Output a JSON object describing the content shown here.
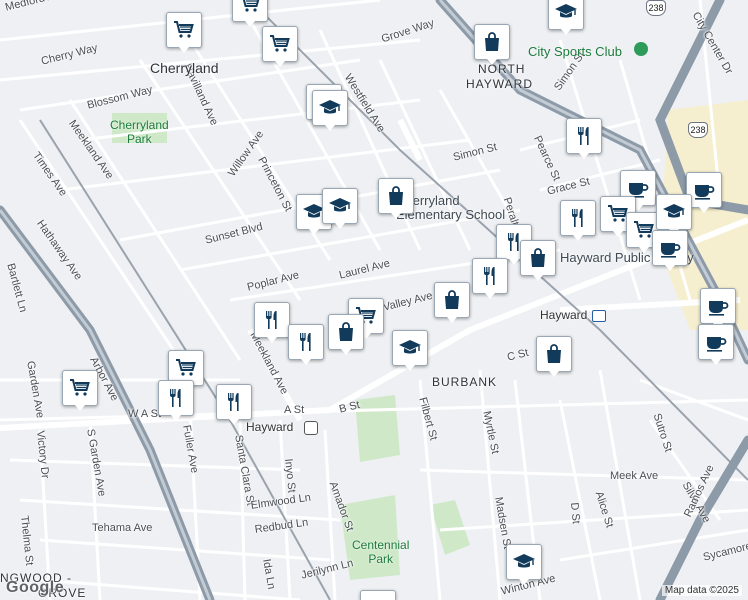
{
  "map": {
    "places": [
      {
        "text": "Cherryland",
        "cls": "place"
      },
      {
        "text": "NORTH",
        "cls": "place hood"
      },
      {
        "text": "HAYWARD",
        "cls": "place hood"
      },
      {
        "text": "BURBANK",
        "cls": "place hood"
      },
      {
        "text": "NGWOOD -",
        "cls": "place hood"
      },
      {
        "text": "GROVE",
        "cls": "place hood"
      }
    ],
    "parks": [
      {
        "text": "Cherryland\nPark"
      },
      {
        "text": "Centennial\nPark"
      }
    ],
    "pois": [
      {
        "text": "City Sports Club"
      }
    ],
    "school_label": "Cherryland Elementary School",
    "library_label": "Hayward Public Library",
    "stations": [
      {
        "text": "Hayward"
      },
      {
        "text": "Hayward"
      }
    ],
    "streets": [
      "Medford Ave",
      "Cherry Way",
      "Blossom Way",
      "Grove Way",
      "Westfield Ave",
      "Havilland Ave",
      "Meekland Ave",
      "Times Ave",
      "Willow Ave",
      "Princeton St",
      "Sunset Blvd",
      "Poplar Ave",
      "Laurel Ave",
      "Valley Ave",
      "Hathaway Ave",
      "Bartlett Ln",
      "Arbor Ave",
      "Garden Ave",
      "S Garden Ave",
      "Victory Dr",
      "Thelma St",
      "W A St",
      "Fuller Ave",
      "Santa Clara St",
      "Inyo St",
      "Amador St",
      "A St",
      "B St",
      "C St",
      "Filbert St",
      "Myrtle St",
      "Madsen St",
      "Simon St",
      "Pearce St",
      "Grace St",
      "Meek Ave",
      "Silva Ave",
      "Sutro St",
      "Alice St",
      "D St",
      "Ramos Ave",
      "Elmwood Ln",
      "Redbud Ln",
      "Tehama Ave",
      "Ida Ln",
      "Jerilynn Ln",
      "Sycamore",
      "Winton Ave",
      "Simon St",
      "Peralta",
      "City Center Dr",
      "Meekland Ave"
    ],
    "highway_shields": [
      "238",
      "238"
    ],
    "attribution": "Map data ©2025",
    "google_logo": "Google",
    "markers": [
      {
        "type": "shop",
        "icon": "shopping-cart-icon"
      },
      {
        "type": "shop",
        "icon": "shopping-cart-icon"
      },
      {
        "type": "shop",
        "icon": "shopping-cart-icon"
      },
      {
        "type": "store",
        "icon": "shopping-bag-icon"
      },
      {
        "type": "school",
        "icon": "graduation-cap-icon"
      },
      {
        "type": "school",
        "icon": "graduation-cap-icon"
      },
      {
        "type": "school",
        "icon": "graduation-cap-icon"
      },
      {
        "type": "school",
        "icon": "graduation-cap-icon"
      },
      {
        "type": "school",
        "icon": "graduation-cap-icon"
      },
      {
        "type": "store",
        "icon": "shopping-bag-icon"
      },
      {
        "type": "restaurant",
        "icon": "fork-knife-icon"
      },
      {
        "type": "cafe",
        "icon": "coffee-cup-icon"
      },
      {
        "type": "cafe",
        "icon": "coffee-cup-icon"
      },
      {
        "type": "restaurant",
        "icon": "fork-knife-icon"
      },
      {
        "type": "restaurant",
        "icon": "fork-knife-icon"
      },
      {
        "type": "shop",
        "icon": "shopping-cart-icon"
      },
      {
        "type": "shop",
        "icon": "shopping-cart-icon"
      },
      {
        "type": "school",
        "icon": "graduation-cap-icon"
      },
      {
        "type": "cafe",
        "icon": "coffee-cup-icon"
      },
      {
        "type": "store",
        "icon": "shopping-bag-icon"
      },
      {
        "type": "restaurant",
        "icon": "fork-knife-icon"
      },
      {
        "type": "store",
        "icon": "shopping-bag-icon"
      },
      {
        "type": "cafe",
        "icon": "coffee-cup-icon"
      },
      {
        "type": "cafe",
        "icon": "coffee-cup-icon"
      },
      {
        "type": "restaurant",
        "icon": "fork-knife-icon"
      },
      {
        "type": "restaurant",
        "icon": "fork-knife-icon"
      },
      {
        "type": "shop",
        "icon": "shopping-cart-icon"
      },
      {
        "type": "store",
        "icon": "shopping-bag-icon"
      },
      {
        "type": "school",
        "icon": "graduation-cap-icon"
      },
      {
        "type": "store",
        "icon": "shopping-bag-icon"
      },
      {
        "type": "shop",
        "icon": "shopping-cart-icon"
      },
      {
        "type": "shop",
        "icon": "shopping-cart-icon"
      },
      {
        "type": "restaurant",
        "icon": "fork-knife-icon"
      },
      {
        "type": "restaurant",
        "icon": "fork-knife-icon"
      },
      {
        "type": "school",
        "icon": "graduation-cap-icon"
      },
      {
        "type": "school",
        "icon": "graduation-cap-icon"
      }
    ],
    "colors": {
      "background": "#eef0f3",
      "road": "#ffffff",
      "highway": "#8d9aa8",
      "rail": "#9aa3ad",
      "park": "#cfe9c8",
      "marker_icon": "#123a5a",
      "park_text": "#1e7b3e",
      "downtown": "#f6efcf"
    }
  }
}
